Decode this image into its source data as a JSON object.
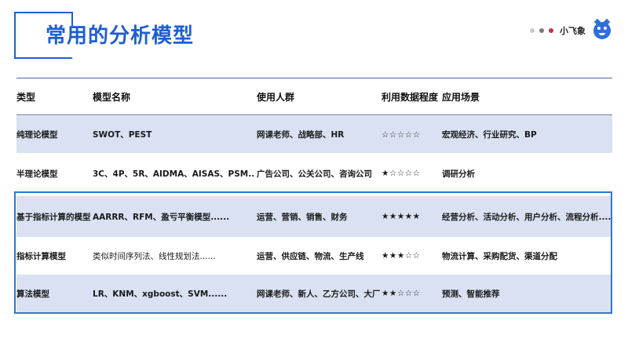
{
  "header": {
    "title": "常用的分析模型",
    "brand_name": "小飞象",
    "dot_colors": [
      "#c9c9c9",
      "#7a7a7a",
      "#c0304b"
    ]
  },
  "table": {
    "headers": [
      "类型",
      "模型名称",
      "使用人群",
      "利用数据程度",
      "应用场景"
    ],
    "rows": [
      {
        "type": "纯理论模型",
        "models": "SWOT、PEST",
        "users": "网课老师、战略部、HR",
        "stars": "☆☆☆☆☆",
        "rating": 0,
        "scenarios": "宏观经济、行业研究、BP"
      },
      {
        "type": "半理论模型",
        "models": "3C、4P、5R、AIDMA、AISAS、PSM......",
        "users": "广告公司、公关公司、咨询公司",
        "stars": "★☆☆☆☆",
        "rating": 1,
        "scenarios": "调研分析"
      },
      {
        "type": "基于指标计算的模型",
        "models": "AARRR、RFM、盈亏平衡模型......",
        "users": "运营、营销、销售、财务",
        "stars": "★★★★★",
        "rating": 5,
        "scenarios": "经营分析、活动分析、用户分析、流程分析......"
      },
      {
        "type": "指标计算模型",
        "models": "类似时间序列法、线性规划法......",
        "users": "运营、供应链、物流、生产线",
        "stars": "★★★☆☆",
        "rating": 3,
        "scenarios": "物流计算、采购配货、渠道分配"
      },
      {
        "type": "算法模型",
        "models": "LR、KNM、xgboost、SVM......",
        "users": "网课老师、新人、乙方公司、大厂",
        "stars": "★★☆☆☆",
        "rating": 2,
        "scenarios": "预测、智能推荐"
      }
    ]
  },
  "colors": {
    "accent": "#1f5fd0",
    "row_shade": "#d9e1f2",
    "highlight_border": "#2c79d1"
  }
}
